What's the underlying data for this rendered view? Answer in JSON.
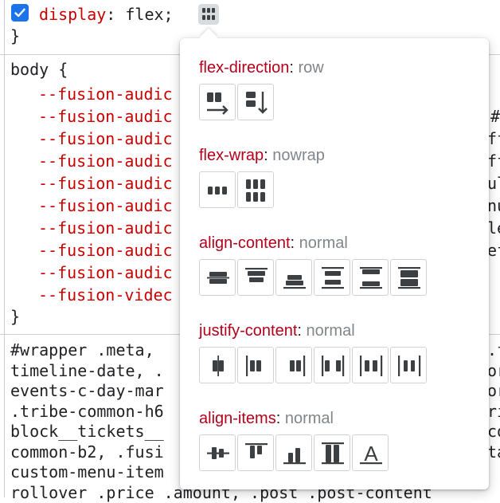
{
  "editor": {
    "display_prop": "display",
    "display_value": "flex;",
    "close_brace_1": "}",
    "body_selector": "body {",
    "var_lines": [
      "--fusion-audic",
      "--fusion-audic",
      "--fusion-audic",
      "--fusion-audic",
      "--fusion-audic",
      "--fusion-audic",
      "--fusion-audic",
      "--fusion-audic",
      "--fusion-audic",
      "--fusion-videc"
    ],
    "right_frags": [
      "#",
      "ff",
      "ff",
      "ul",
      "nu",
      "le",
      "ef"
    ],
    "close_brace_2": "}",
    "selector_lines": [
      "#wrapper .meta,",
      "timeline-date, .",
      "events-c-day-mar",
      ".tribe-common-h6",
      "block__tickets__",
      "common-b2, .fusi",
      "custom-menu-item",
      "rollover .price .amount, .post .post-content"
    ],
    "selector_right_frags": [
      ".f",
      "or",
      "or",
      "ri",
      "co",
      "ta"
    ]
  },
  "popover": {
    "sections": [
      {
        "name": "flex-direction",
        "value": "row",
        "buttons": [
          "flex-direction-row-icon",
          "flex-direction-column-icon"
        ]
      },
      {
        "name": "flex-wrap",
        "value": "nowrap",
        "buttons": [
          "flex-wrap-nowrap-icon",
          "flex-wrap-wrap-icon"
        ]
      },
      {
        "name": "align-content",
        "value": "normal",
        "buttons": [
          "align-content-center-icon",
          "align-content-flex-start-icon",
          "align-content-flex-end-icon",
          "align-content-space-around-icon",
          "align-content-space-between-icon",
          "align-content-stretch-icon"
        ]
      },
      {
        "name": "justify-content",
        "value": "normal",
        "buttons": [
          "justify-content-center-icon",
          "justify-content-flex-start-icon",
          "justify-content-flex-end-icon",
          "justify-content-space-between-icon",
          "justify-content-space-around-icon",
          "justify-content-space-evenly-icon"
        ]
      },
      {
        "name": "align-items",
        "value": "normal",
        "buttons": [
          "align-items-center-icon",
          "align-items-flex-start-icon",
          "align-items-flex-end-icon",
          "align-items-stretch-icon",
          "align-items-baseline-icon"
        ]
      }
    ]
  },
  "colors": {
    "property_name": "#c80000",
    "popover_title": "#b3001b",
    "value_gray": "#80868b",
    "checkbox": "#1a73e8"
  }
}
